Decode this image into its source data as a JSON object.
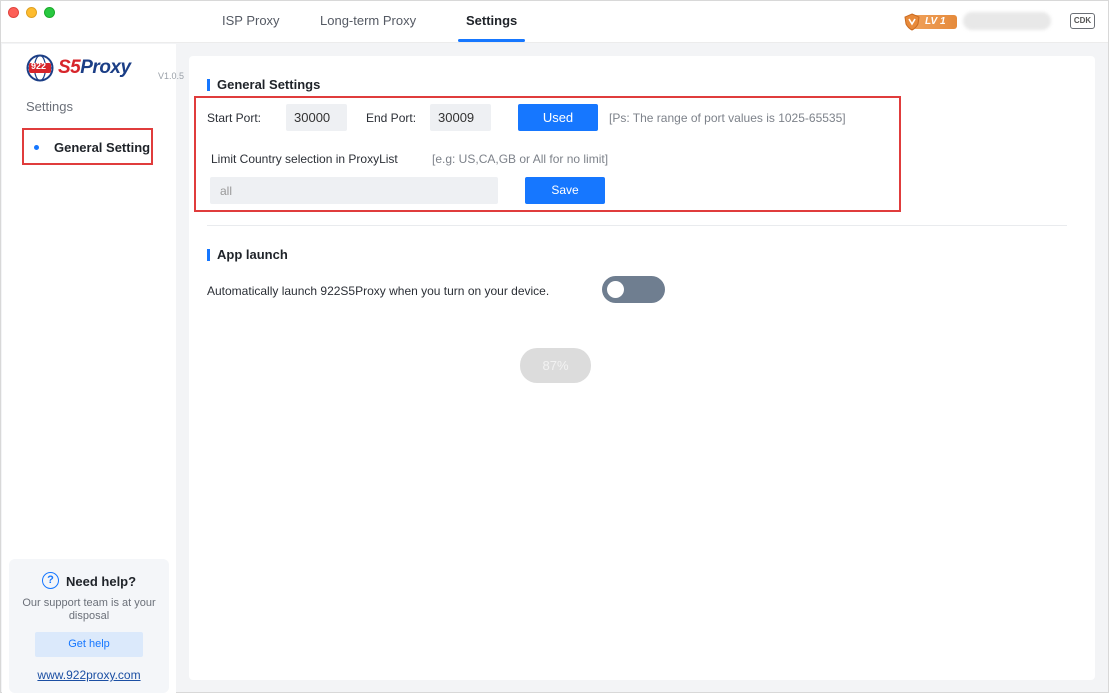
{
  "titlebar": {
    "tabs": [
      {
        "label": "ISP Proxy",
        "active": false
      },
      {
        "label": "Long-term Proxy",
        "active": false
      },
      {
        "label": "Settings",
        "active": true
      }
    ],
    "level_badge": "LV 1",
    "cdk_label": "CDK",
    "accent_color": "#1677ff"
  },
  "sidebar": {
    "logo": {
      "brand": "922",
      "name_s5": "S5",
      "name_proxy": "Proxy",
      "version": "V1.0.5"
    },
    "heading": "Settings",
    "items": [
      {
        "label": "General Setting",
        "selected": true
      }
    ],
    "help": {
      "title": "Need help?",
      "description": "Our support team is at your disposal",
      "button_label": "Get help",
      "link": "www.922proxy.com"
    }
  },
  "general_settings": {
    "title": "General Settings",
    "start_port_label": "Start Port:",
    "start_port_value": "30000",
    "end_port_label": "End Port:",
    "end_port_value": "30009",
    "used_button": "Used",
    "port_hint": "[Ps: The range of port values is 1025-65535]",
    "country_label": "Limit Country selection in ProxyList",
    "country_hint": "[e.g: US,CA,GB or All for no limit]",
    "country_value": "all",
    "save_button": "Save"
  },
  "app_launch": {
    "title": "App launch",
    "auto_launch_label": "Automatically launch 922S5Proxy when you turn on your device.",
    "auto_launch_enabled": false
  },
  "progress": {
    "label": "87%",
    "value": 87
  }
}
